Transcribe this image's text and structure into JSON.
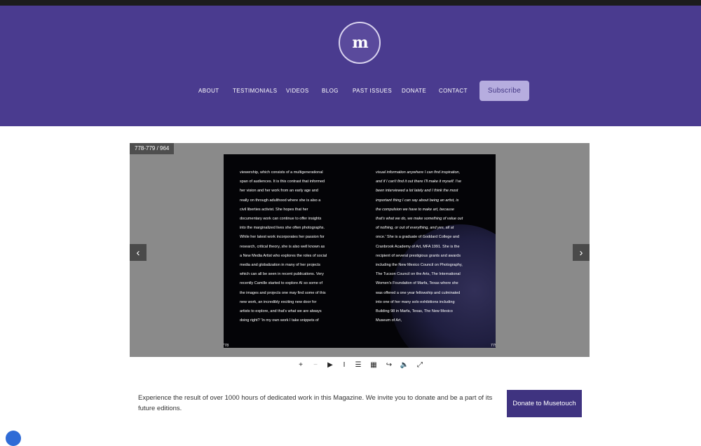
{
  "header": {
    "logo_text": "m",
    "nav": [
      "ABOUT",
      "TESTIMONIALS",
      "VIDEOS",
      "BLOG",
      "PAST ISSUES",
      "DONATE",
      "CONTACT"
    ],
    "subscribe_label": "Subscribe"
  },
  "viewer": {
    "page_count": "778-779 / 964",
    "left_page_number": "778",
    "right_page_number": "779",
    "left_page_lines": [
      {
        "t": "viewership, which consists of a multigenerational",
        "i": false
      },
      {
        "t": "span of audiences. It is this contrast that informed",
        "i": false
      },
      {
        "t": "her vision and her work from an early age and",
        "i": false
      },
      {
        "t": "really on through adulthood where she is also a",
        "i": false
      },
      {
        "t": "civil liberties activist. She hopes that her",
        "i": false
      },
      {
        "t": "documentary work can continue to offer insights",
        "i": false
      },
      {
        "t": "into the marginalized lives she often photographs.",
        "i": false
      },
      {
        "t": "While her latest work incorporates her passion for",
        "i": false
      },
      {
        "t": "research, critical theory, she is also well known as",
        "i": false
      },
      {
        "t": "a New Media Artist who explores the roles of social",
        "i": false
      },
      {
        "t": "media and globalization in many of her projects",
        "i": false
      },
      {
        "t": "which can all be seen in recent publications. Very",
        "i": false
      },
      {
        "t": "recently Camille started to explore AI so some of",
        "i": false
      },
      {
        "t": "the images and projects one may find some of this",
        "i": false
      },
      {
        "t": "new work, an incredibly exciting new door for",
        "i": false
      },
      {
        "t": "artists to explore, and that's what we are always",
        "i": false
      },
      {
        "t": "doing right?  'In my own work I take snippets of",
        "i": false
      }
    ],
    "right_page_lines": [
      {
        "t": "visual information anywhere I can find inspiration,",
        "i": true
      },
      {
        "t": "and if I can't find it out there I'll make it myself. I've",
        "i": true
      },
      {
        "t": "been interviewed a lot lately and I think the most",
        "i": true
      },
      {
        "t": "important thing I can say about being an artist, is",
        "i": true
      },
      {
        "t": "the compulsion we have to make art, because",
        "i": true
      },
      {
        "t": "that's what we do, we make something of value out",
        "i": true
      },
      {
        "t": "of nothing, or out of everything, and yes, all at",
        "i": true
      },
      {
        "t": "once.' She is a graduate of Goddard College and",
        "i": false
      },
      {
        "t": "Cranbrook Academy of Art, MFA 1991. She is the",
        "i": false
      },
      {
        "t": "recipient of several prestigious grants and awards",
        "i": false
      },
      {
        "t": "including the New Mexico Council on Photography,",
        "i": false
      },
      {
        "t": "The Tucson Council on the Arts, The International",
        "i": false
      },
      {
        "t": "Women's Foundation of Marfa, Texas where she",
        "i": false
      },
      {
        "t": "was offered a one year fellowship and culminated",
        "i": false
      },
      {
        "t": "into one of her many solo exhibitions including",
        "i": false
      },
      {
        "t": "Building 98 in Marfa, Texas, The New Mexico",
        "i": false
      },
      {
        "t": "Museum of Art,",
        "i": false
      }
    ],
    "prev_icon": "chevron-left-icon",
    "next_icon": "chevron-right-icon"
  },
  "toolbar": [
    {
      "name": "zoom-in-icon",
      "glyph": "+"
    },
    {
      "name": "zoom-out-icon",
      "glyph": "−"
    },
    {
      "name": "play-icon",
      "glyph": "▶"
    },
    {
      "name": "text-cursor-icon",
      "glyph": "I"
    },
    {
      "name": "table-of-contents-icon",
      "glyph": "☰"
    },
    {
      "name": "thumbnails-icon",
      "glyph": "▦"
    },
    {
      "name": "share-icon",
      "glyph": "↪"
    },
    {
      "name": "sound-icon",
      "glyph": "🔈"
    },
    {
      "name": "fullscreen-icon",
      "glyph": "⤢"
    }
  ],
  "promo": {
    "text": "Experience the result of over 1000 hours of dedicated work in this Magazine. We invite you to donate and be a part of its future editions.",
    "donate_label": "Donate to Musetouch"
  },
  "colors": {
    "header": "#4a3b8f",
    "accent": "#3f3380",
    "subscribe": "#b6addf",
    "viewer_bg": "#8a8a8a"
  }
}
